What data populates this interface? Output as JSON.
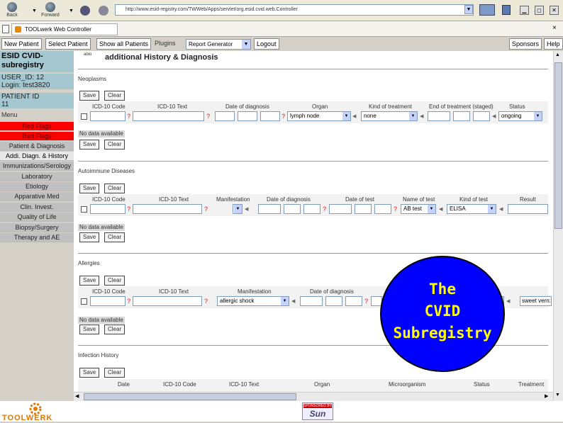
{
  "browser": {
    "back_label": "Back",
    "forward_label": "Forward",
    "address": "http://www.esid-registry.com/TWWeb/Apps/servlet/org.esid.cvid.web.Controller",
    "tab_title": "TOOLwerk Web Controller",
    "tab_close": "×"
  },
  "nav": {
    "new_patient": "New Patient",
    "select_patient": "Select Patient",
    "show_all": "Show all Patients",
    "plugins": "Plugins",
    "report_generator": "Report Generator",
    "logout": "Logout",
    "sponsors": "Sponsors",
    "help": "Help"
  },
  "sidebar": {
    "title_line1": "ESID CVID-",
    "title_line2": "subregistry",
    "user_id": "USER_ID: 12",
    "login": "Login: test3820",
    "patient_id_label": "PATIENT ID",
    "patient_id": "11",
    "menu_label": "Menu",
    "items": [
      {
        "label": "Red Flags",
        "style": "red"
      },
      {
        "label": "Red Flags",
        "style": "red"
      },
      {
        "label": "Patient & Diagnosis",
        "style": "gray"
      },
      {
        "label": "Addi. Diagn. & History",
        "style": "light"
      },
      {
        "label": "Immunizations/Serology",
        "style": "gray"
      },
      {
        "label": "Laboratory",
        "style": "gray"
      },
      {
        "label": "Etiology",
        "style": "gray"
      },
      {
        "label": "Apparative Med",
        "style": "gray"
      },
      {
        "label": "Clin. Invest.",
        "style": "gray"
      },
      {
        "label": "Quality of Life",
        "style": "gray"
      },
      {
        "label": "Biopsy/Surgery",
        "style": "gray"
      },
      {
        "label": "Therapy and AE",
        "style": "gray"
      }
    ]
  },
  "page": {
    "badge": "abio",
    "title": "additional History & Diagnosis"
  },
  "buttons": {
    "save": "Save",
    "clear": "Clear"
  },
  "neoplasms": {
    "title": "Neoplasms",
    "headers": [
      "ICD-10 Code",
      "ICD-10 Text",
      "Date of diagnosis",
      "Organ",
      "Kind of treatment",
      "End of treatment (staged)",
      "Status"
    ],
    "organ": "lymph node",
    "treatment": "none",
    "status": "ongoing",
    "no_data": "No data available"
  },
  "autoimmune": {
    "title": "Autoimmune Diseases",
    "headers": [
      "ICD-10 Code",
      "ICD-10 Text",
      "Manifestation",
      "Date of diagnosis",
      "Date of test",
      "Name of test",
      "Kind of test",
      "Result"
    ],
    "name_of_test": "AB test",
    "kind_of_test": "ELISA",
    "no_data": "No data available"
  },
  "allergies": {
    "title": "Allergies",
    "headers": [
      "ICD-10 Code",
      "ICD-10 Text",
      "Manifestation",
      "Date of diagnosis"
    ],
    "manifestation": "allergic shock",
    "extra": "sweet vern:",
    "no_data": "No data available"
  },
  "infection": {
    "title": "Infection History",
    "headers": [
      "Date",
      "ICD-10 Code",
      "ICD-10 Text",
      "Organ",
      "Microorganism",
      "Status",
      "Treatment"
    ]
  },
  "overlay": {
    "line1": "The",
    "line2": "CVID",
    "line3": "Subregistry"
  },
  "footer": {
    "logo_text": "TOOLWERK",
    "sun_top": "SPONSORED BY",
    "sun_name": "Sun"
  },
  "colors": {
    "sidebar_blue": "#a5c8d0",
    "red_flag": "#ff0000",
    "circle_fill": "#0000ff",
    "circle_text": "#ffff00"
  }
}
